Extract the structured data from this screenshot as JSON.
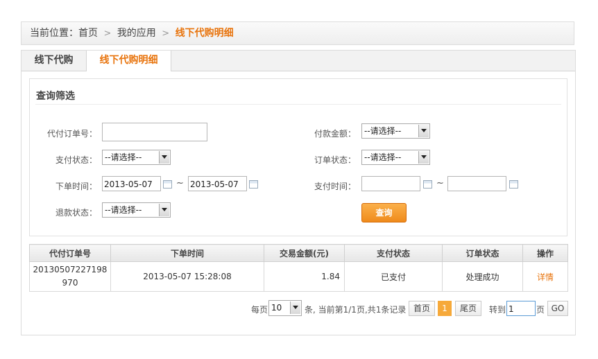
{
  "breadcrumb": {
    "prefix": "当前位置：",
    "home": "首页",
    "sep1": ">",
    "apps": "我的应用",
    "sep2": ">",
    "current": "线下代购明细"
  },
  "tabs": [
    {
      "label": "线下代购"
    },
    {
      "label": "线下代购明细"
    }
  ],
  "filter": {
    "title": "查询筛选",
    "order_no_label": "代付订单号：",
    "order_no_value": "",
    "pay_status_label": "支付状态：",
    "pay_status_value": "--请选择--",
    "order_time_label": "下单时间：",
    "order_time_from": "2013-05-07",
    "order_time_to": "2013-05-07",
    "range_sep": "~",
    "refund_status_label": "退款状态：",
    "refund_status_value": "--请选择--",
    "amount_label": "付款金额：",
    "amount_value": "--请选择--",
    "order_status_label": "订单状态：",
    "order_status_value": "--请选择--",
    "pay_time_label": "支付时间：",
    "pay_time_from": "",
    "pay_time_to": "",
    "query_button": "查询"
  },
  "table": {
    "headers": [
      "代付订单号",
      "下单时间",
      "交易金额(元)",
      "支付状态",
      "订单状态",
      "操作"
    ],
    "rows": [
      {
        "order_no_line1": "20130507227198",
        "order_no_line2": "970",
        "order_time": "2013-05-07 15:28:08",
        "amount": "1.84",
        "pay_status": "已支付",
        "order_status": "处理成功",
        "action": "详情"
      }
    ]
  },
  "pagination": {
    "per_page_label": "每页",
    "per_page_value": "10",
    "summary": "条, 当前第1/1页,共1条记录",
    "first": "首页",
    "current_page": "1",
    "last": "尾页",
    "goto_label": "转到",
    "goto_value": "1",
    "page_suffix": "页",
    "go": "GO"
  },
  "colors": {
    "accent": "#e8740d",
    "button": "#f39a2b"
  }
}
